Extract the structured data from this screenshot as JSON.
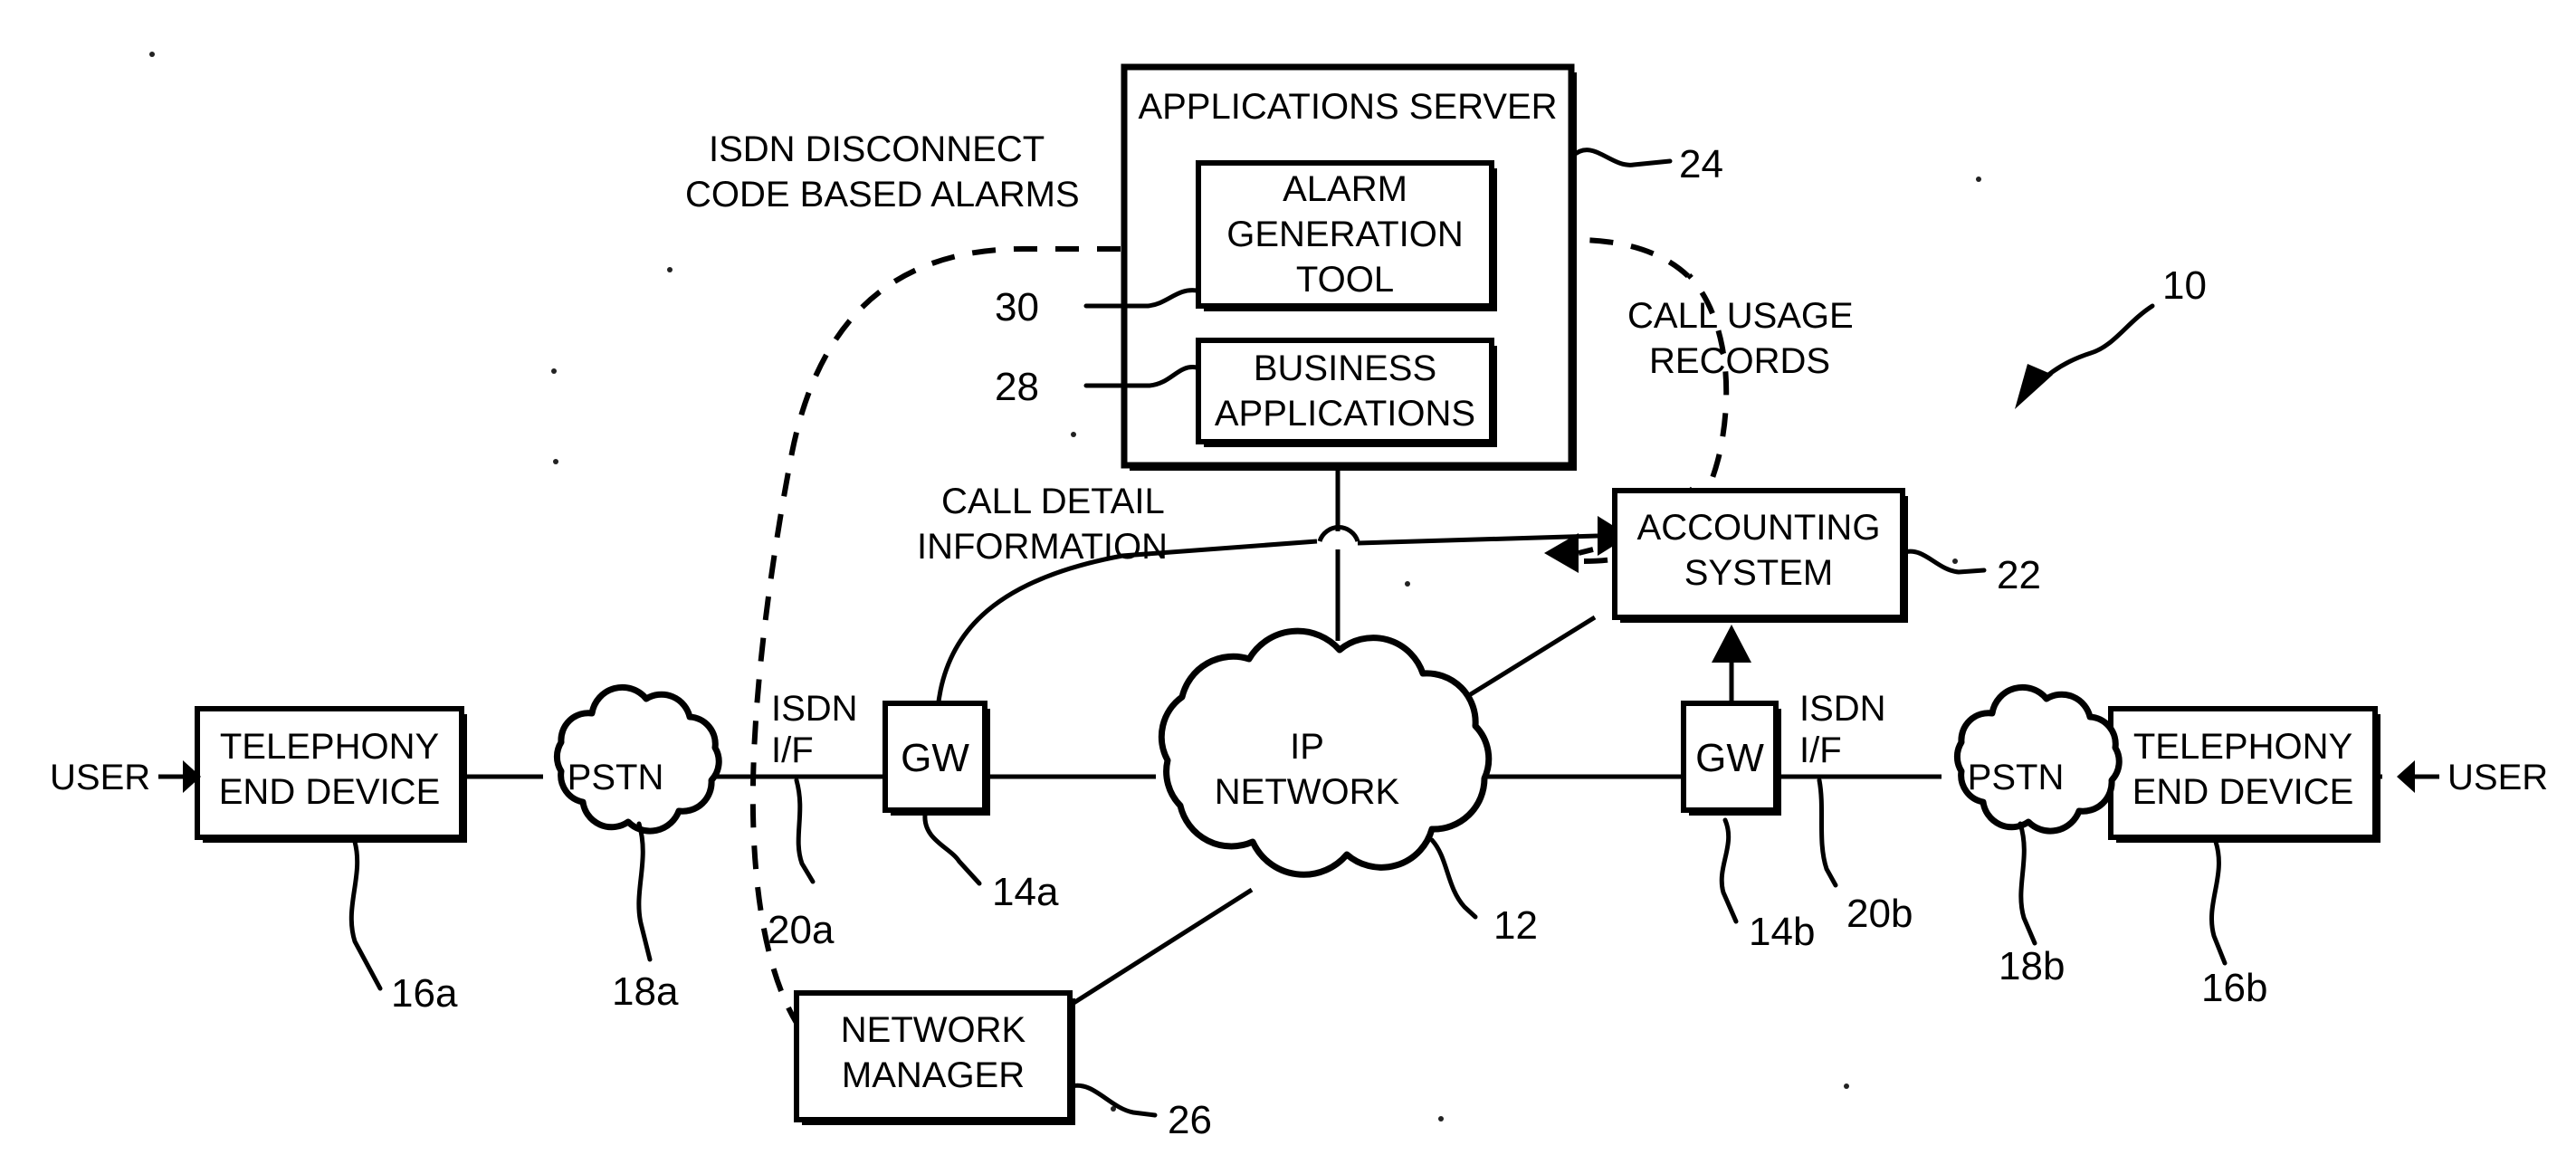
{
  "figure": {
    "id": "10",
    "background": "#ffffff",
    "ink": "#000000"
  },
  "nodes": {
    "applications_server": {
      "label": "APPLICATIONS SERVER",
      "ref": "24"
    },
    "alarm_generation_tool": {
      "line1": "ALARM",
      "line2": "GENERATION",
      "line3": "TOOL",
      "ref": "30"
    },
    "business_applications": {
      "line1": "BUSINESS",
      "line2": "APPLICATIONS",
      "ref": "28"
    },
    "accounting_system": {
      "line1": "ACCOUNTING",
      "line2": "SYSTEM",
      "ref": "22"
    },
    "network_manager": {
      "line1": "NETWORK",
      "line2": "MANAGER",
      "ref": "26"
    },
    "ip_network": {
      "line1": "IP",
      "line2": "NETWORK",
      "ref": "12"
    },
    "gateway_a": {
      "label": "GW",
      "ref": "14a"
    },
    "gateway_b": {
      "label": "GW",
      "ref": "14b"
    },
    "pstn_a": {
      "label": "PSTN",
      "ref": "18a"
    },
    "pstn_b": {
      "label": "PSTN",
      "ref": "18b"
    },
    "telephony_end_device_a": {
      "line1": "TELEPHONY",
      "line2": "END DEVICE",
      "ref": "16a"
    },
    "telephony_end_device_b": {
      "line1": "TELEPHONY",
      "line2": "END DEVICE",
      "ref": "16b"
    },
    "isdn_if_a": {
      "line1": "ISDN",
      "line2": "I/F",
      "ref": "20a"
    },
    "isdn_if_b": {
      "line1": "ISDN",
      "line2": "I/F",
      "ref": "20b"
    },
    "user_left": {
      "label": "USER"
    },
    "user_right": {
      "label": "USER"
    }
  },
  "flow_labels": {
    "isdn_disconnect_alarms": {
      "line1": "ISDN DISCONNECT",
      "line2": "CODE BASED ALARMS"
    },
    "call_detail_information": {
      "line1": "CALL DETAIL",
      "line2": "INFORMATION"
    },
    "call_usage_records": {
      "line1": "CALL USAGE",
      "line2": "RECORDS"
    }
  },
  "reference_numerals": [
    "10",
    "12",
    "14a",
    "14b",
    "16a",
    "16b",
    "18a",
    "18b",
    "20a",
    "20b",
    "22",
    "24",
    "26",
    "28",
    "30"
  ]
}
